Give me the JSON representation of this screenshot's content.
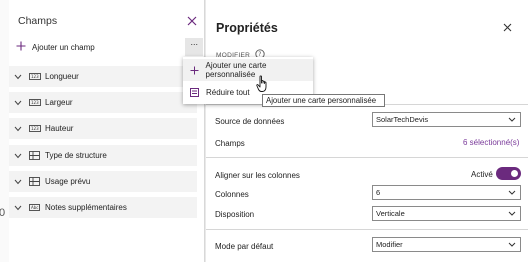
{
  "background": {
    "partial_digit": "0"
  },
  "champs": {
    "title": "Champs",
    "add_field_label": "Ajouter un champ",
    "more_label": "···",
    "fields": [
      {
        "label": "Longueur",
        "icon": "number-icon",
        "tag": "123"
      },
      {
        "label": "Largeur",
        "icon": "number-icon",
        "tag": "123"
      },
      {
        "label": "Hauteur",
        "icon": "number-icon",
        "tag": "123"
      },
      {
        "label": "Type de structure",
        "icon": "choice-grid-icon"
      },
      {
        "label": "Usage prévu",
        "icon": "choice-grid-icon"
      },
      {
        "label": "Notes supplémentaires",
        "icon": "text-icon",
        "tag": "Abc"
      }
    ]
  },
  "menu": {
    "items": [
      {
        "label": "Ajouter une carte personnalisée",
        "icon": "plus-icon"
      },
      {
        "label": "Réduire tout",
        "icon": "collapse-icon"
      }
    ]
  },
  "tooltip": {
    "text": "Ajouter une carte personnalisée"
  },
  "props": {
    "title": "Propriétés",
    "section_label": "MODIFIER",
    "rows": {
      "data_source": {
        "label": "Source de données",
        "value": "SolarTechDevis"
      },
      "fields": {
        "label": "Champs",
        "value": "6 sélectionné(s)"
      },
      "snap_columns": {
        "label": "Aligner sur les colonnes",
        "status": "Activé",
        "on": true
      },
      "columns": {
        "label": "Colonnes",
        "value": "6"
      },
      "layout": {
        "label": "Disposition",
        "value": "Verticale"
      },
      "default_mode": {
        "label": "Mode par défaut",
        "value": "Modifier"
      }
    }
  },
  "colors": {
    "accent": "#6b2a7e",
    "link": "#7a3a9a"
  }
}
